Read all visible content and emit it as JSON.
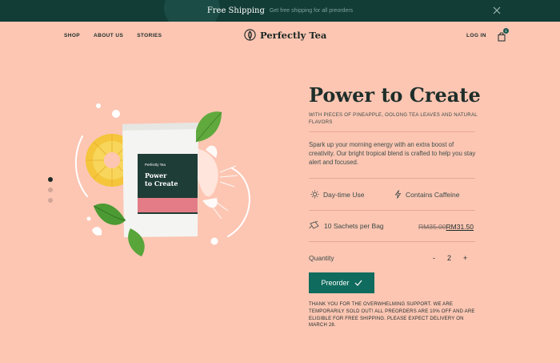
{
  "announcement": {
    "title": "Free Shipping",
    "subtitle": "Get free shipping for all preorders",
    "close_icon": "close-icon"
  },
  "header": {
    "nav": [
      "SHOP",
      "ABOUT US",
      "STORIES"
    ],
    "logo_text": "Perfectly Tea",
    "login": "LOG IN",
    "cart_count": "1"
  },
  "gallery": {
    "active_index": 0,
    "count": 3,
    "package": {
      "brand": "Perfectly Tea",
      "line1": "Power",
      "line2": "to Create"
    }
  },
  "product": {
    "title": "Power to Create",
    "subtitle": "WITH PIECES OF PINEAPPLE, OOLONG TEA LEAVES AND NATURAL FLAVORS",
    "description": "Spark up your morning energy with an extra boost of creativity. Our bright tropical blend is crafted to help you stay alert and focused.",
    "feature_1": "Day-time Use",
    "feature_2": "Contains Caffeine",
    "sachets": "10 Sachets per Bag",
    "old_price": "RM35.00",
    "new_price": "RM31.50",
    "quantity_label": "Quantity",
    "quantity_minus": "-",
    "quantity_value": "2",
    "quantity_plus": "+",
    "button_label": "Preorder",
    "note": "THANK YOU FOR THE OVERWHELMING SUPPORT. WE ARE TEMPORARILY SOLD OUT! ALL PREORDERS ARE 10% OFF AND ARE ELIGIBLE FOR FREE SHIPPING. PLEASE EXPECT DELIVERY ON MARCH 28."
  },
  "colors": {
    "background": "#fcc6b3",
    "topbar": "#123c36",
    "button": "#0f6b5d",
    "text": "#1d2b28"
  }
}
